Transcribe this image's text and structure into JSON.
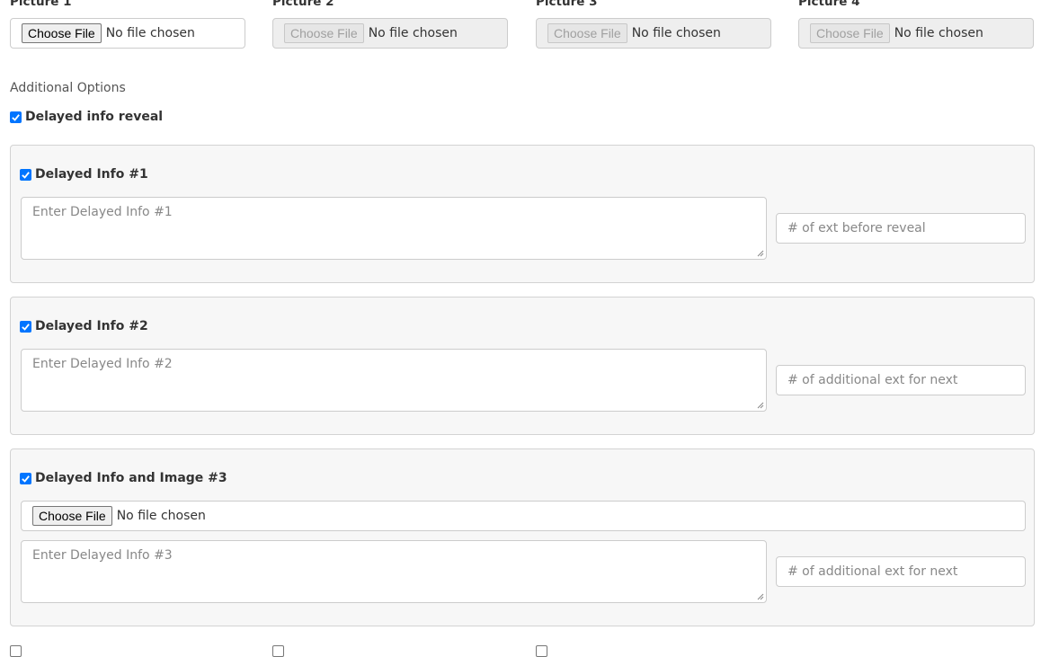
{
  "pictures": [
    {
      "label": "Picture 1",
      "button": "Choose File",
      "status": "No file chosen",
      "enabled": true
    },
    {
      "label": "Picture 2",
      "button": "Choose File",
      "status": "No file chosen",
      "enabled": false
    },
    {
      "label": "Picture 3",
      "button": "Choose File",
      "status": "No file chosen",
      "enabled": false
    },
    {
      "label": "Picture 4",
      "button": "Choose File",
      "status": "No file chosen",
      "enabled": false
    }
  ],
  "additional_options": {
    "heading": "Additional Options",
    "delayed_reveal": {
      "label": "Delayed info reveal",
      "checked": true
    }
  },
  "delayed_items": [
    {
      "label": "Delayed Info #1",
      "checked": true,
      "textarea_placeholder": "Enter Delayed Info #1",
      "number_placeholder": "# of ext before reveal"
    },
    {
      "label": "Delayed Info #2",
      "checked": true,
      "textarea_placeholder": "Enter Delayed Info #2",
      "number_placeholder": "# of additional ext for next"
    },
    {
      "label": "Delayed Info and Image #3",
      "checked": true,
      "file_button": "Choose File",
      "file_status": "No file chosen",
      "textarea_placeholder": "Enter Delayed Info #3",
      "number_placeholder": "# of additional ext for next"
    }
  ],
  "bottom_checkboxes": [
    {
      "checked": false
    },
    {
      "checked": false
    },
    {
      "checked": false
    }
  ]
}
